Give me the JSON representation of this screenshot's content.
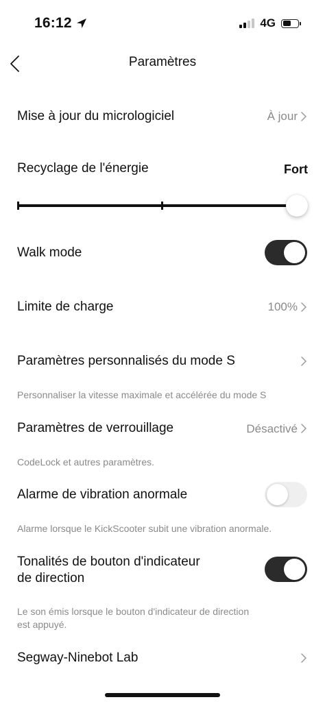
{
  "status_bar": {
    "time": "16:12",
    "network": "4G",
    "location_icon": "location-arrow-icon",
    "signal_icon": "cellular-signal-icon",
    "battery_icon": "battery-icon"
  },
  "header": {
    "title": "Paramètres",
    "back_icon": "chevron-left-icon"
  },
  "settings": {
    "firmware": {
      "label": "Mise à jour du micrologiciel",
      "value": "À jour"
    },
    "energy_recycling": {
      "label": "Recyclage de l'énergie",
      "value": "Fort",
      "level_index": 2,
      "levels_count": 3
    },
    "walk_mode": {
      "label": "Walk mode",
      "enabled": true
    },
    "charge_limit": {
      "label": "Limite de charge",
      "value": "100%"
    },
    "s_mode": {
      "label": "Paramètres personnalisés du mode S",
      "description": "Personnaliser la vitesse maximale et accélérée du mode S"
    },
    "lock": {
      "label": "Paramètres de verrouillage",
      "value": "Désactivé",
      "description": "CodeLock et autres paramètres."
    },
    "vibration_alarm": {
      "label": "Alarme de vibration anormale",
      "enabled": false,
      "description": "Alarme lorsque le KickScooter subit une vibration anormale."
    },
    "indicator_tones": {
      "label_line1": "Tonalités de bouton d'indicateur",
      "label_line2": "de direction",
      "enabled": true,
      "description_line1": "Le son émis lorsque le bouton d'indicateur de direction",
      "description_line2": "est appuyé."
    },
    "lab": {
      "label": "Segway-Ninebot Lab"
    }
  },
  "colors": {
    "toggle_on": "#2b2b2b",
    "toggle_off": "#efefef",
    "secondary_text": "#8a8a8a"
  }
}
